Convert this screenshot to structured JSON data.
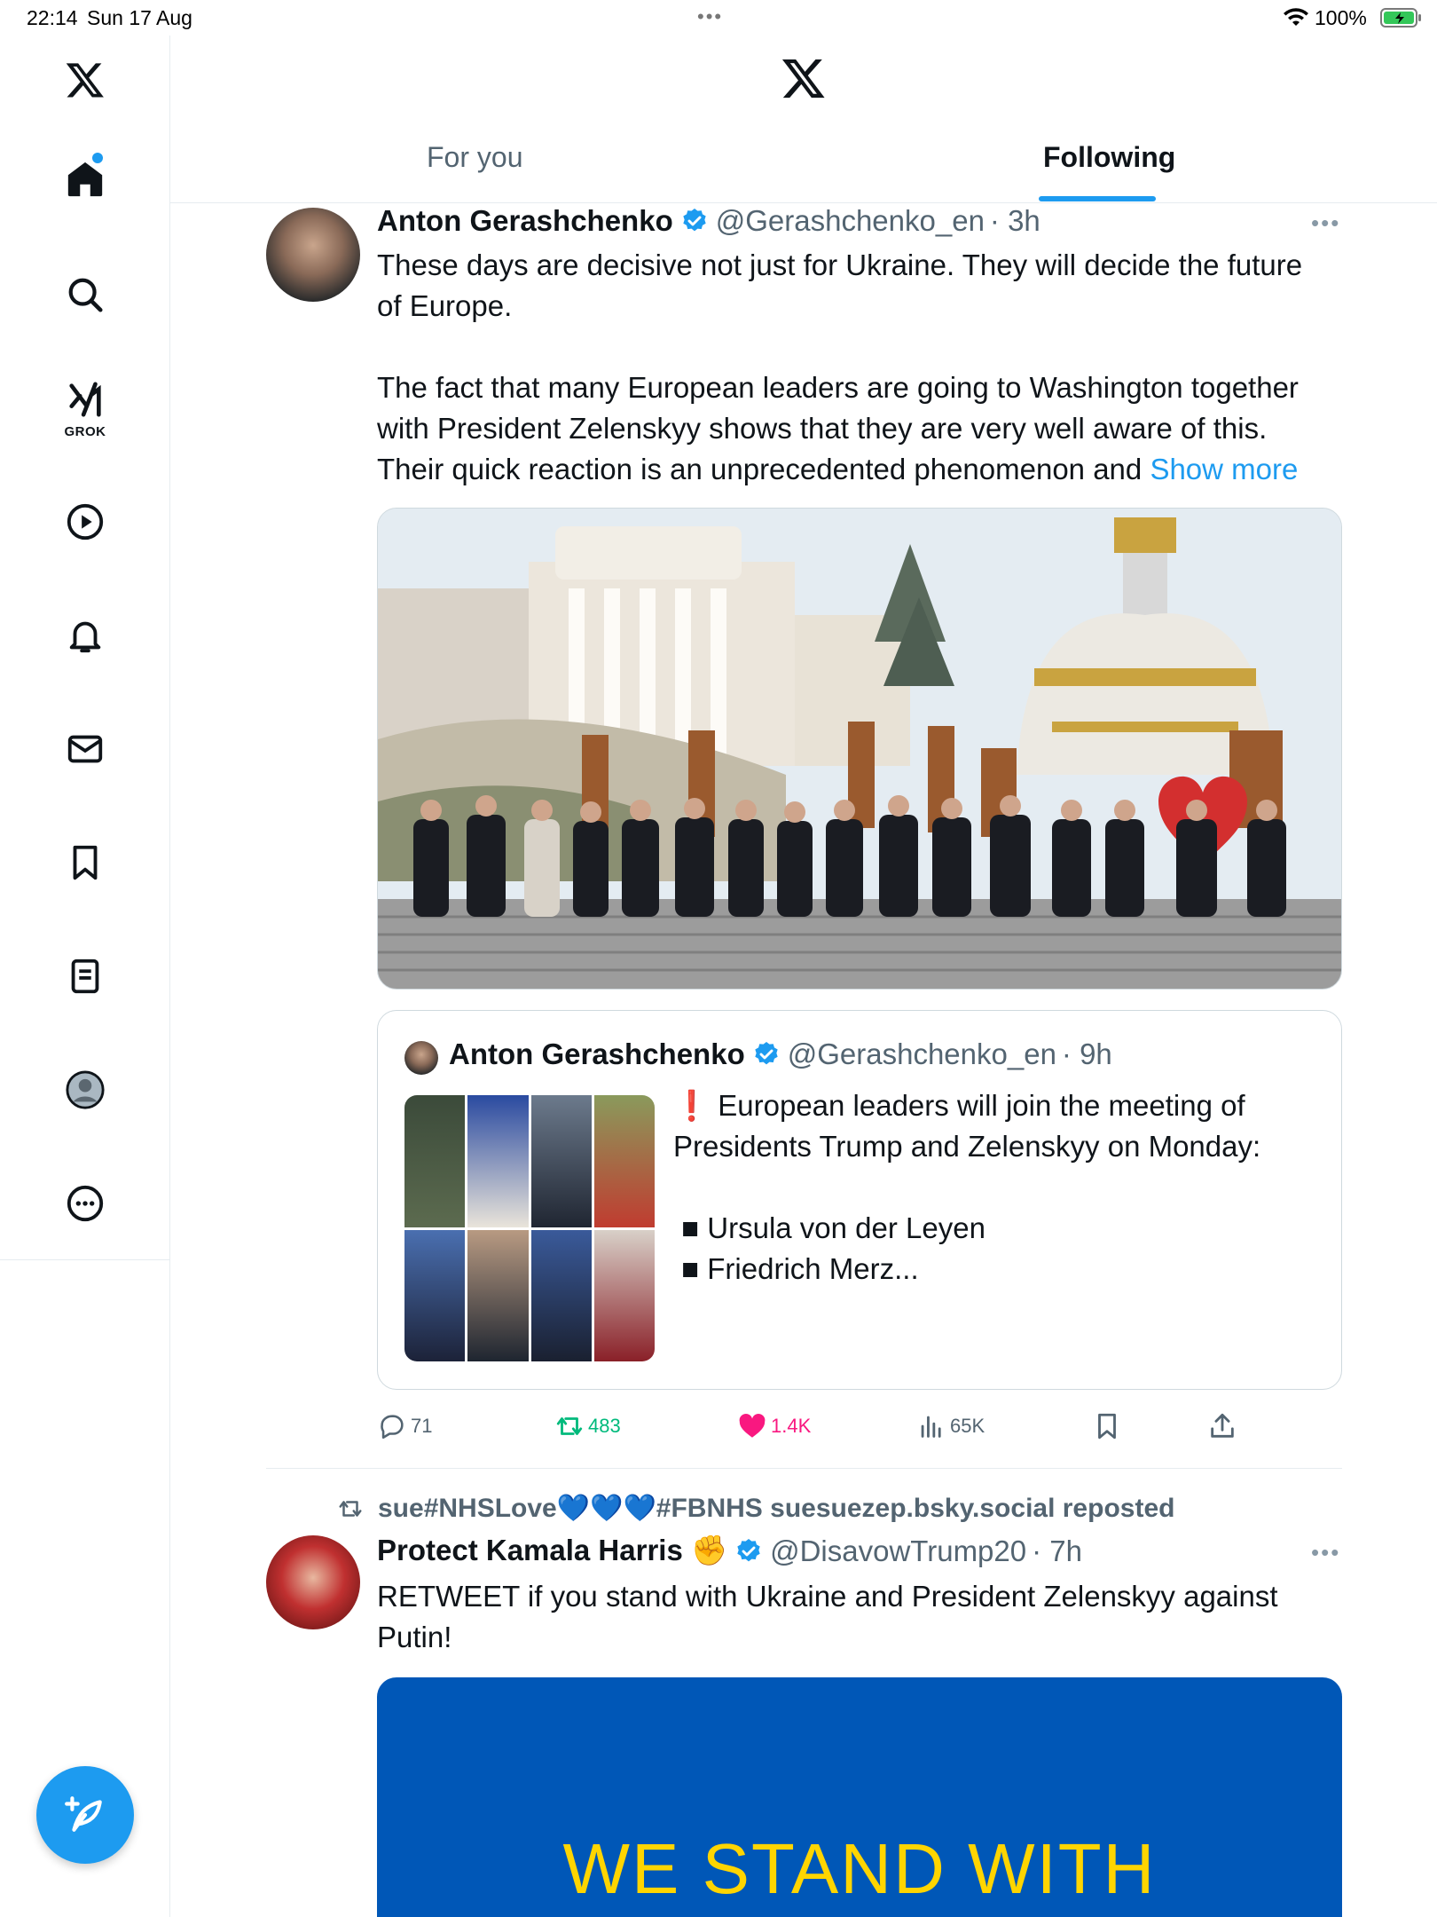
{
  "status_bar": {
    "time": "22:14",
    "date": "Sun 17 Aug",
    "battery": "100%"
  },
  "icons": {
    "sidebar": [
      "x-logo-icon",
      "home-icon",
      "search-icon",
      "grok-icon",
      "video-icon",
      "bell-icon",
      "mail-icon",
      "bookmark-icon",
      "lists-icon",
      "profile-icon",
      "more-icon"
    ],
    "compose": "compose-icon"
  },
  "sidebar": {
    "grok_label": "GROK"
  },
  "tabs": [
    {
      "label": "For you",
      "selected": false
    },
    {
      "label": "Following",
      "selected": true
    }
  ],
  "colors": {
    "accent": "#1d9bf0",
    "like": "#f91880",
    "repost": "#00ba7c"
  },
  "tweets": [
    {
      "name": "Anton Gerashchenko",
      "handle": "@Gerashchenko_en",
      "time": "· 3h",
      "text": "These days are decisive not just for Ukraine. They will decide the future\nof Europe.\n\nThe fact that many European leaders are going to Washington together\nwith President Zelenskyy shows that they are very well aware of this.\nTheir quick reaction is an unprecedented phenomenon and ",
      "show_more": "Show more",
      "quote": {
        "name": "Anton Gerashchenko",
        "handle": "@Gerashchenko_en",
        "time": "· 9h",
        "text": "❗ European leaders will join the meeting of\nPresidents Trump and Zelenskyy on Monday:\n\n ■ Ursula von der Leyen\n ■ Friedrich Merz..."
      },
      "stats": {
        "replies": "71",
        "reposts": "483",
        "likes": "1.4K",
        "views": "65K"
      }
    },
    {
      "repost_by": "sue#NHSLove💙💙💙#FBNHS suesuezep.bsky.social reposted",
      "name": "Protect Kamala Harris ✊",
      "handle": "@DisavowTrump20",
      "time": "· 7h",
      "text": "RETWEET if you stand with Ukraine and President Zelenskyy against\nPutin!",
      "media_text": "WE STAND WITH"
    }
  ]
}
